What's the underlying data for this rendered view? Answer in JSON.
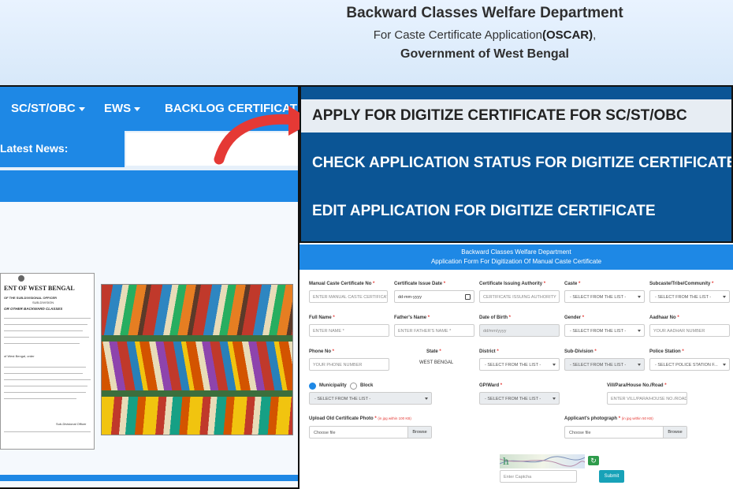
{
  "header": {
    "title": "Backward Classes Welfare Department",
    "subtitle_prefix": "For Caste Certificate Application",
    "subtitle_bold": "(OSCAR)",
    "subtitle_suffix": ",",
    "subtitle2": "Government of West Bengal"
  },
  "left_panel": {
    "nav": {
      "items": [
        {
          "label": "SC/ST/OBC"
        },
        {
          "label": "EWS"
        },
        {
          "label": "BACKLOG CERTIFICATE"
        }
      ]
    },
    "latest_news_label": "Latest News:",
    "certificate": {
      "title": "ENT OF WEST BENGAL",
      "line2": "OF THE SUB-DIVISIONAL OFFICER",
      "line3": "SUB-DIVISION",
      "line4": "OR OTHER BACKWARD CLASSES",
      "line5": "of West Bengal, order",
      "line6": "Sub-Divisional Officer"
    }
  },
  "right_menu": {
    "items": [
      {
        "label": "APPLY FOR DIGITIZE CERTIFICATE FOR SC/ST/OBC"
      },
      {
        "label": "CHECK APPLICATION STATUS FOR DIGITIZE CERTIFICATE"
      },
      {
        "label": "EDIT APPLICATION FOR DIGITIZE CERTIFICATE"
      }
    ]
  },
  "form": {
    "header_line1": "Backward Classes Welfare Department",
    "header_line2": "Application Form For Digitization Of Manual Caste Certificate",
    "required_mark": "*",
    "fields": {
      "manual_no": {
        "label": "Manual Caste Certificate No",
        "placeholder": "ENTER MANUAL CASTE CERTIFICATE NO"
      },
      "issue_date": {
        "label": "Certificate Issue Date",
        "placeholder": "dd-mm-yyyy"
      },
      "issuing_authority": {
        "label": "Certificate Issuing Authority",
        "placeholder": "CERTIFICATE ISSUING AUTHORITY"
      },
      "caste": {
        "label": "Caste",
        "selected": "- SELECT FROM THE LIST -"
      },
      "subcaste": {
        "label": "Subcaste/Tribe/Community",
        "selected": "- SELECT FROM THE LIST -"
      },
      "full_name": {
        "label": "Full Name",
        "placeholder": "ENTER NAME *"
      },
      "father_name": {
        "label": "Father's Name",
        "placeholder": "ENTER FATHER'S NAME *"
      },
      "dob": {
        "label": "Date of Birth",
        "placeholder": "dd/mm/yyyy"
      },
      "gender": {
        "label": "Gender",
        "selected": "- SELECT FROM THE LIST -"
      },
      "aadhaar": {
        "label": "Aadhaar No",
        "placeholder": "YOUR AADHAR NUMBER"
      },
      "phone": {
        "label": "Phone No",
        "placeholder": "YOUR PHONE NUMBER"
      },
      "state": {
        "label": "State",
        "value": "WEST BENGAL"
      },
      "district": {
        "label": "District",
        "selected": "- SELECT FROM THE LIST -"
      },
      "subdivision": {
        "label": "Sub-Division",
        "selected": "- SELECT FROM THE LIST -"
      },
      "police_station": {
        "label": "Police Station",
        "selected": "- SELECT POLICE STATION F..."
      },
      "area_type": {
        "options": [
          "Municipality",
          "Block"
        ],
        "selected": "Municipality"
      },
      "municipality": {
        "selected": "- SELECT FROM THE LIST -"
      },
      "gp_ward": {
        "label": "GP/Ward",
        "selected": "- SELECT FROM THE LIST -"
      },
      "vill": {
        "label": "Vill/Para/House No./Road",
        "placeholder": "ENTER VILL/PARA/HOUSE NO./ROAD"
      },
      "old_photo": {
        "label": "Upload Old Certificate Photo",
        "hint": "(in jpg within 100 KB)",
        "choose": "Choose file",
        "browse": "Browse"
      },
      "applicant_photo": {
        "label": "Applicant's photograph",
        "hint": "(in jpg within 50 KB)",
        "choose": "Choose file",
        "browse": "Browse"
      },
      "captcha": {
        "placeholder": "Enter Captcha",
        "text": "h 4"
      }
    },
    "submit_label": "Submit"
  },
  "colors": {
    "nav_blue": "#1e88e5",
    "menu_dark_blue": "#0b5595",
    "arrow_red": "#e53935",
    "submit_teal": "#17a2b8",
    "refresh_green": "#2e9b4b"
  }
}
